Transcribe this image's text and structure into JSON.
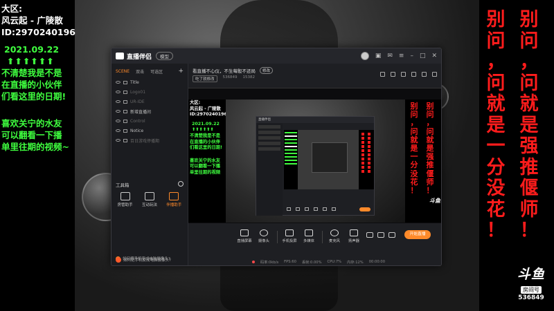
{
  "overlay_left": {
    "region": "大区:",
    "server": "风云起 - 广陵散",
    "id_line": "ID:2970240196",
    "date": "2021.09.22",
    "arrows": "⬆⬆⬆⬆⬆⬆",
    "lines1": [
      "不清楚我是不是",
      "在直播的小伙伴",
      "们看这里的日期!"
    ],
    "lines2": [
      "喜欢关宁的水友",
      "可以翻看一下播",
      "单里往期的视频~"
    ]
  },
  "overlay_right": {
    "col1": [
      "别",
      "问",
      "，",
      "问",
      "就",
      "是",
      "一",
      "分",
      "没",
      "花",
      "！"
    ],
    "col2": [
      "别",
      "问",
      "，",
      "问",
      "就",
      "是",
      "强",
      "推",
      "偃",
      "师",
      "！"
    ],
    "logo_mark": "斗鱼",
    "logo_sub": "房间号",
    "room_number": "536849"
  },
  "app": {
    "name": "直播伴侣",
    "mode_label": "模型",
    "tabs": [
      "SCENE",
      "双击",
      "可选区"
    ],
    "scenes": [
      {
        "label": "Title",
        "dim": false
      },
      {
        "label": "Logo01",
        "dim": true
      },
      {
        "label": "UR-IDE",
        "dim": true
      },
      {
        "label": "新增直播间",
        "dim": false
      },
      {
        "label": "Control",
        "dim": true
      },
      {
        "label": "Notice",
        "dim": false
      },
      {
        "label": "百日游戏停播期",
        "dim": true
      }
    ],
    "tools_title": "工具箱",
    "tools": [
      {
        "label": "房管助手",
        "active": false
      },
      {
        "label": "互动玩法",
        "active": false
      },
      {
        "label": "伴播助手",
        "active": true
      }
    ],
    "help_text": "如何把手机变成电脑摄像头?",
    "room_title": "看直播不心仪，不生莓骰不还局",
    "edit_label": "修改",
    "category": "吃了就修改",
    "room_id": "536849",
    "follower_count": "15382",
    "controls": [
      "直播屏幕",
      "摄像头",
      "手机投屏",
      "多媒体",
      "麦克风",
      "扬声器"
    ],
    "start_button": "开始直播",
    "status": [
      "码率:0kb/s",
      "FPS:60",
      "丢帧:0.00%",
      "CPU:7%",
      "内存:12%",
      "00:00:00"
    ]
  },
  "preview_overlay": {
    "region": "大区:",
    "server": "风云起 - 广陵散",
    "id_line": "ID:2970240196",
    "date": "2021.09.22",
    "arrows": "⬆⬆⬆⬆⬆⬆",
    "lines1": [
      "不清楚我是不是",
      "在直播的小伙伴",
      "们看这里的日期!"
    ],
    "lines2": [
      "喜欢关宁的水友",
      "可以翻看一下播",
      "单里往期的视频"
    ]
  },
  "preview_right": {
    "col1": [
      "别",
      "问",
      "，",
      "问",
      "就",
      "是",
      "一",
      "分",
      "没",
      "花",
      "！"
    ],
    "col2": [
      "别",
      "问",
      "，",
      "问",
      "就",
      "是",
      "强",
      "推",
      "偃",
      "师",
      "！"
    ],
    "logo": "斗鱼"
  },
  "nested_window": {
    "title": "直播伴侣"
  }
}
